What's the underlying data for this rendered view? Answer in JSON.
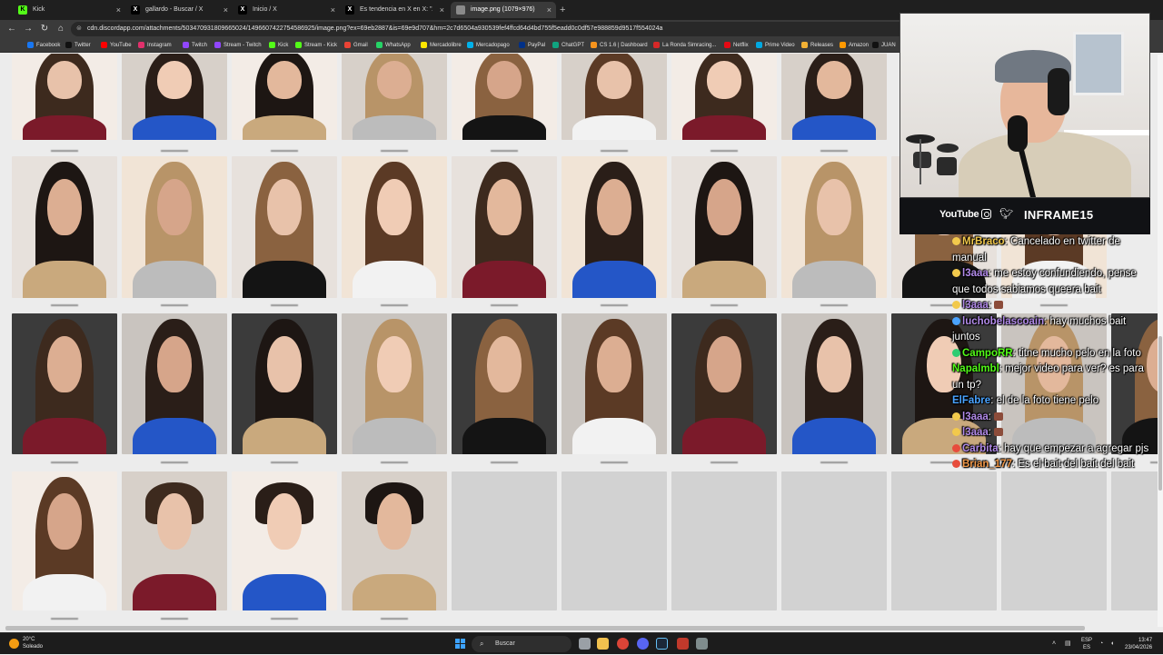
{
  "browser": {
    "tabs": [
      {
        "label": "Kick",
        "favicon_color": "#53fc18",
        "favicon_glyph": "K"
      },
      {
        "label": "gallardo - Buscar / X",
        "favicon_color": "#111111",
        "favicon_glyph": "X"
      },
      {
        "label": "Inicio / X",
        "favicon_color": "#111111",
        "favicon_glyph": "X"
      },
      {
        "label": "Es tendencia en X en X: \"Argentina\"",
        "favicon_color": "#111111",
        "favicon_glyph": "X"
      },
      {
        "label": "image.png (1079×976)",
        "favicon_color": "#8a8a8a",
        "favicon_glyph": ""
      }
    ],
    "url": "cdn.discordapp.com/attachments/503470931809665024/1496607422754586925/image.png?ex=69eb2887&is=69e9d707&hm=2c7d6504a930539fef4ffcd64d4bd755f5eadd0c0df57e988859d9517f554024a",
    "bookmarks": [
      {
        "label": "Facebook",
        "color": "#1877f2"
      },
      {
        "label": "Twitter",
        "color": "#111111"
      },
      {
        "label": "YouTube",
        "color": "#ff0000"
      },
      {
        "label": "Instagram",
        "color": "#e1306c"
      },
      {
        "label": "Twitch",
        "color": "#9146ff"
      },
      {
        "label": "Stream - Twitch",
        "color": "#9146ff"
      },
      {
        "label": "Kick",
        "color": "#53fc18"
      },
      {
        "label": "Stream - Kick",
        "color": "#53fc18"
      },
      {
        "label": "Gmail",
        "color": "#ea4335"
      },
      {
        "label": "WhatsApp",
        "color": "#25d366"
      },
      {
        "label": "Mercadolibre",
        "color": "#ffe600"
      },
      {
        "label": "Mercadopago",
        "color": "#00b1ea"
      },
      {
        "label": "PayPal",
        "color": "#003087"
      },
      {
        "label": "ChatGPT",
        "color": "#10a37f"
      },
      {
        "label": "CS 1.6 | Dashboard",
        "color": "#f7941d"
      },
      {
        "label": "La Ronda Simracing...",
        "color": "#d62828"
      },
      {
        "label": "Netflix",
        "color": "#e50914"
      },
      {
        "label": "Prime Video",
        "color": "#00a8e1"
      },
      {
        "label": "Releases",
        "color": "#f2b134"
      },
      {
        "label": "Amazon",
        "color": "#ff9900"
      },
      {
        "label": "JUAN",
        "color": "#111111"
      }
    ]
  },
  "stream": {
    "social": {
      "youtube": "YouTube",
      "handle": "INFRAME15"
    },
    "chat": [
      {
        "user": "MrBraco",
        "user_color": "#f2c94c",
        "badge_color": "#f2c94c",
        "text": ": Cancelado en twitter de manual",
        "emote": false
      },
      {
        "user": "l3aaa",
        "user_color": "#b18ae8",
        "badge_color": "#f2c94c",
        "text": ": me estoy confundiendo, pense que todos sabiamos queera bait",
        "emote": false
      },
      {
        "user": "l3aaa",
        "user_color": "#b18ae8",
        "badge_color": "#f2c94c",
        "text": ":",
        "emote": true
      },
      {
        "user": "luchobelascoain",
        "user_color": "#b18ae8",
        "badge_color": "#4aa3ff",
        "text": ": hay muchos bait juntos",
        "emote": false
      },
      {
        "user": "CampoRR",
        "user_color": "#53fc18",
        "badge_color": "#2ecc71",
        "text": ": titne mucho pelo en la foto",
        "emote": false
      },
      {
        "user": "Napalmbl",
        "user_color": "#53fc18",
        "badge_color": "",
        "text": ": mejor video para ver? es para un tp?",
        "emote": false
      },
      {
        "user": "ElFabre",
        "user_color": "#4aa3ff",
        "badge_color": "",
        "text": ": el de la foto tiene pelo",
        "emote": false
      },
      {
        "user": "l3aaa",
        "user_color": "#b18ae8",
        "badge_color": "#f2c94c",
        "text": ":",
        "emote": true
      },
      {
        "user": "l3aaa",
        "user_color": "#b18ae8",
        "badge_color": "#f2c94c",
        "text": ":",
        "emote": true
      },
      {
        "user": "Carbita",
        "user_color": "#b18ae8",
        "badge_color": "#e74c3c",
        "text": ": hay que empezar a agregar pjs",
        "emote": false
      },
      {
        "user": "Brian_177",
        "user_color": "#f2994a",
        "badge_color": "#e74c3c",
        "text": ": Es el bait del bait del bait",
        "emote": false
      }
    ]
  },
  "taskbar": {
    "weather_temp": "20°C",
    "weather_desc": "Soleado",
    "search_placeholder": "Buscar",
    "lang_top": "ESP",
    "lang_bottom": "ES",
    "time": "13:47",
    "date": "23/04/2026"
  },
  "palette": {
    "skin": [
      "#e8c2aa",
      "#dcae92",
      "#f0ccb5",
      "#d6a58a",
      "#e3b89c"
    ],
    "hair": [
      "#2a1e18",
      "#3d2a1e",
      "#5b3a25",
      "#8a6240",
      "#b89468",
      "#1d1613"
    ],
    "shirt": [
      "#141414",
      "#f2f2f2",
      "#7b1a2a",
      "#2456c7",
      "#c9a97d",
      "#bcbcbc"
    ],
    "backdrop": [
      "#f3ece6",
      "#e7e1dc",
      "#3b3b3b",
      "#d7d0c9",
      "#f1e4d6",
      "#c9c4bf"
    ]
  }
}
